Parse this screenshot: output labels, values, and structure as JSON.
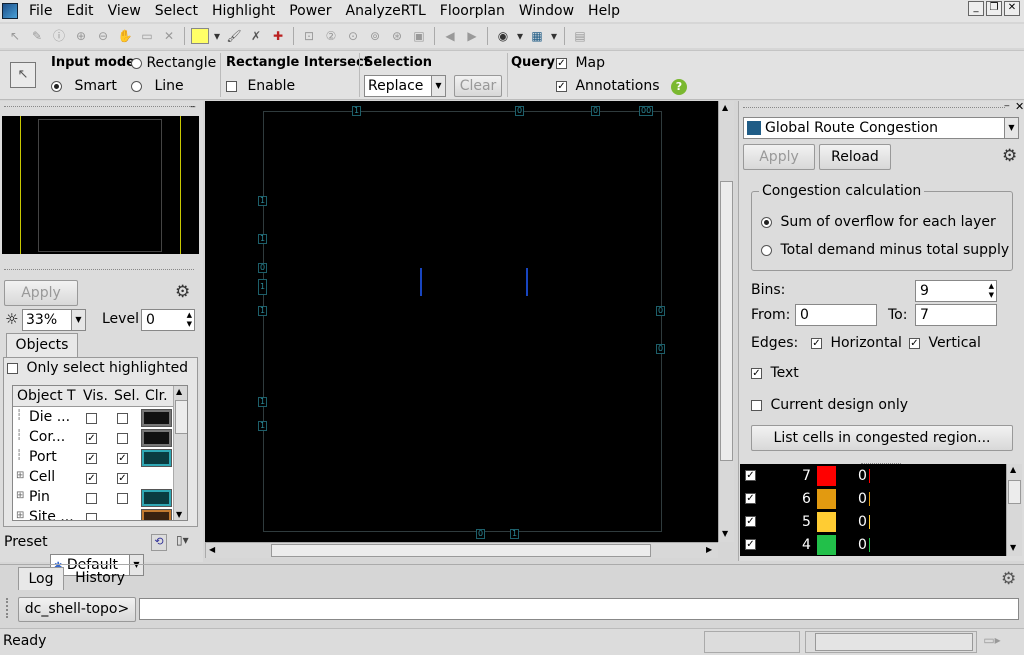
{
  "menu": [
    "File",
    "Edit",
    "View",
    "Select",
    "Highlight",
    "Power",
    "AnalyzeRTL",
    "Floorplan",
    "Window",
    "Help"
  ],
  "options": {
    "input_mode_label": "Input mode",
    "mode_rectangle": "Rectangle",
    "mode_smart": "Smart",
    "mode_line": "Line",
    "rect_intersect_label": "Rectangle Intersect",
    "enable_label": "Enable",
    "selection_label": "Selection",
    "selection_value": "Replace",
    "clear_label": "Clear",
    "query_label": "Query",
    "map_label": "Map",
    "annotations_label": "Annotations"
  },
  "left": {
    "apply_label": "Apply",
    "brightness": "33%",
    "level_label": "Level",
    "level_value": "0",
    "objects_tab": "Objects",
    "only_select_label": "Only select highlighted",
    "columns": [
      "Object T",
      "Vis.",
      "Sel.",
      "Clr."
    ],
    "rows": [
      {
        "name": "Die ...",
        "vis": false,
        "sel": false,
        "color": "#111111",
        "expand": false
      },
      {
        "name": "Cor...",
        "vis": true,
        "sel": false,
        "color": "#111111",
        "expand": false
      },
      {
        "name": "Port",
        "vis": true,
        "sel": true,
        "color": "#0a3b40",
        "expand": false
      },
      {
        "name": "Cell",
        "vis": true,
        "sel": true,
        "color": "",
        "expand": true
      },
      {
        "name": "Pin",
        "vis": false,
        "sel": false,
        "color": "#0a3b40",
        "expand": true
      },
      {
        "name": "Site ...",
        "vis": false,
        "sel": null,
        "color": "#3a2210",
        "expand": true
      }
    ],
    "preset_label": "Preset",
    "preset_value": "Default"
  },
  "canvas_labels": [
    "1",
    "0",
    "0",
    "00",
    "1",
    "1",
    "0",
    "1",
    "1",
    "0",
    "0",
    "1",
    "1",
    "0",
    "1"
  ],
  "right": {
    "map_type": "Global Route Congestion",
    "apply_label": "Apply",
    "reload_label": "Reload",
    "congestion_title": "Congestion calculation",
    "opt_sum": "Sum of overflow for each layer",
    "opt_total": "Total demand minus total supply",
    "bins_label": "Bins:",
    "bins_value": "9",
    "from_label": "From:",
    "from_value": "0",
    "to_label": "To:",
    "to_value": "7",
    "edges_label": "Edges:",
    "horizontal_label": "Horizontal",
    "vertical_label": "Vertical",
    "text_label": "Text",
    "current_design_label": "Current design only",
    "list_cells_label": "List cells in congested region...",
    "legend": [
      {
        "level": "7",
        "color": "#ff0000",
        "count": "0"
      },
      {
        "level": "6",
        "color": "#e29a10",
        "count": "0"
      },
      {
        "level": "5",
        "color": "#ffcc33",
        "count": "0"
      },
      {
        "level": "4",
        "color": "#22c04a",
        "count": "0"
      }
    ]
  },
  "bottom": {
    "tab_log": "Log",
    "tab_history": "History",
    "prompt": "dc_shell-topo>",
    "status": "Ready"
  }
}
